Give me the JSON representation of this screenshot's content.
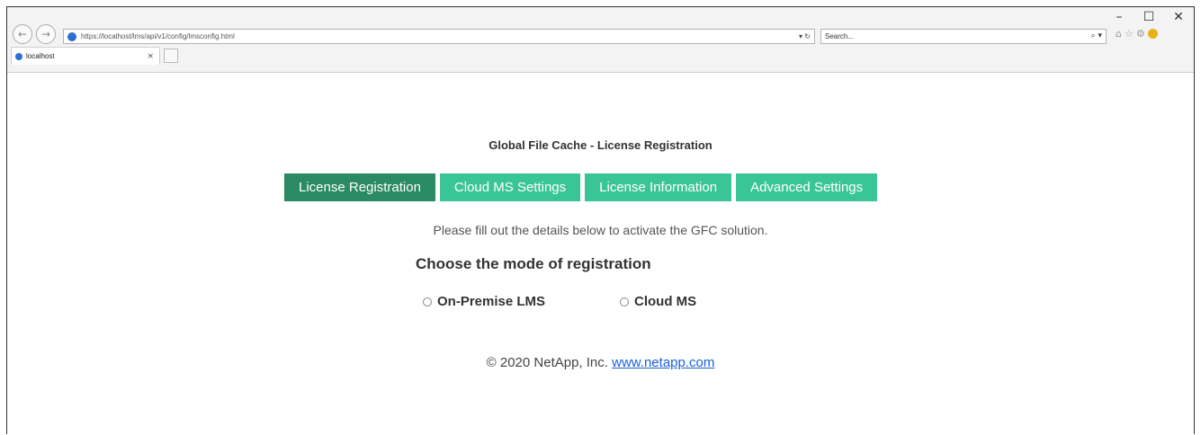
{
  "browser": {
    "address_url": "https://localhost/lms/api/v1/config/lmsconfig.html",
    "address_tools": "▾ ↻",
    "search_placeholder": "Search...",
    "search_button": "⌕ ▾",
    "tab_title": "localhost",
    "tab_close": "×",
    "window_controls": {
      "minimize": "–",
      "maximize": "☐",
      "close": "✕"
    },
    "nav": {
      "back": "←",
      "forward": "→"
    },
    "toolbar_icons": {
      "home": "⌂",
      "favorites": "☆",
      "settings": "⚙"
    }
  },
  "page": {
    "title": "Global File Cache - License Registration",
    "tabs": [
      {
        "label": "License Registration",
        "active": true
      },
      {
        "label": "Cloud MS Settings",
        "active": false
      },
      {
        "label": "License Information",
        "active": false
      },
      {
        "label": "Advanced Settings",
        "active": false
      }
    ],
    "instruction": "Please fill out the details below to activate the GFC solution.",
    "mode_heading": "Choose the mode of registration",
    "options": [
      {
        "label": "On-Premise LMS"
      },
      {
        "label": "Cloud MS"
      }
    ],
    "footer": {
      "copyright": "© 2020 NetApp, Inc.",
      "link": "www.netapp.com"
    }
  },
  "colors": {
    "tab_active": "#2a8a61",
    "tab_inactive": "#3ac596",
    "link": "#1a5fd6"
  }
}
